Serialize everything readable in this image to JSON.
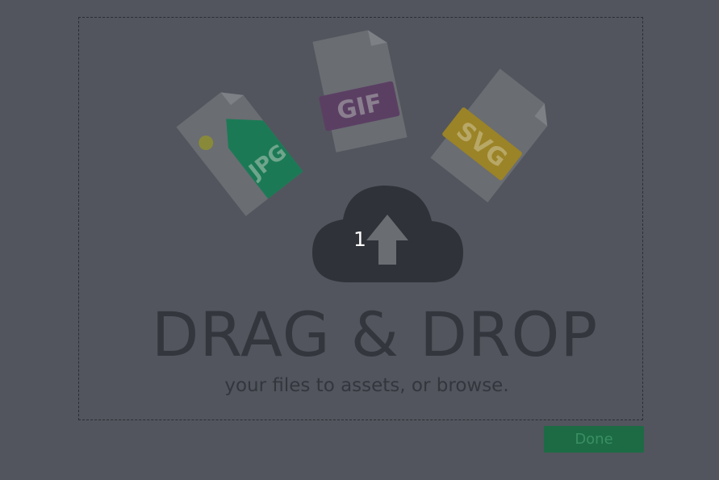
{
  "dropzone": {
    "file_types": [
      {
        "name": "jpg-file-icon",
        "label": "JPG",
        "color": "#1b7a55"
      },
      {
        "name": "gif-file-icon",
        "label": "GIF",
        "color": "#5b3f63"
      },
      {
        "name": "svg-file-icon",
        "label": "SVG",
        "color": "#9b8327"
      }
    ],
    "upload_count": "1",
    "headline": "DRAG & DROP",
    "subline_prefix": "your files to assets, or ",
    "browse_link": "browse",
    "subline_suffix": "."
  },
  "footer": {
    "done_label": "Done"
  },
  "colors": {
    "overlay_background": "#52555d",
    "cloud": "#2f3238",
    "text": "#33363d",
    "done_button": "#1c6b44"
  }
}
